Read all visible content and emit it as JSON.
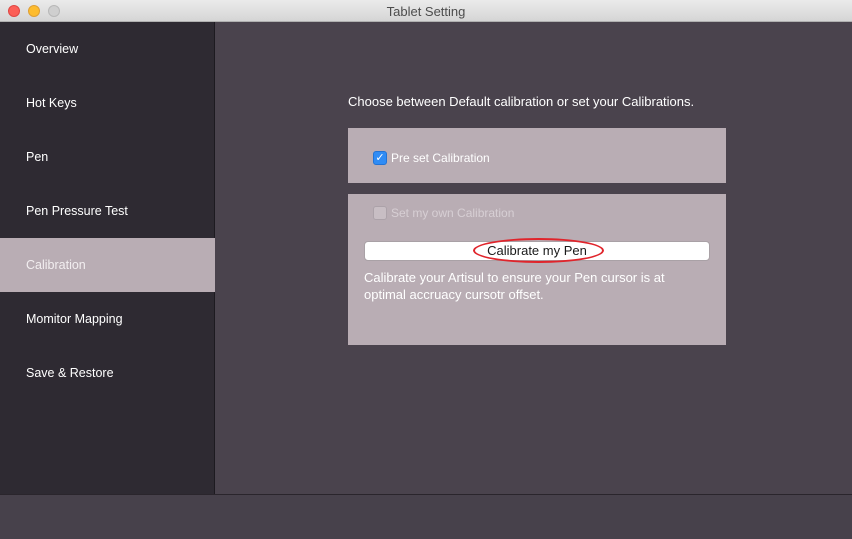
{
  "window": {
    "title": "Tablet Setting"
  },
  "sidebar": {
    "items": [
      {
        "label": "Overview",
        "active": false
      },
      {
        "label": "Hot Keys",
        "active": false
      },
      {
        "label": "Pen",
        "active": false
      },
      {
        "label": "Pen Pressure Test",
        "active": false
      },
      {
        "label": "Calibration",
        "active": true
      },
      {
        "label": "Momitor Mapping",
        "active": false
      },
      {
        "label": "Save & Restore",
        "active": false
      }
    ]
  },
  "main": {
    "heading": "Choose between Default calibration or set your Calibrations.",
    "preset": {
      "label": "Pre set Calibration",
      "checked": true
    },
    "custom": {
      "label": "Set my own Calibration",
      "checked": false,
      "button_label": "Calibrate my Pen",
      "description": "Calibrate your Artisul to ensure your Pen cursor is at optimal accruacy cursotr offset."
    }
  },
  "colors": {
    "background": "#4a434d",
    "sidebar": "#2e2a32",
    "active_item": "#b9adb4",
    "panel": "#b9adb4",
    "checkbox_checked": "#2f8cf5",
    "highlight": "#e0242b"
  },
  "icons": {
    "checkmark": "checkmark-icon"
  }
}
